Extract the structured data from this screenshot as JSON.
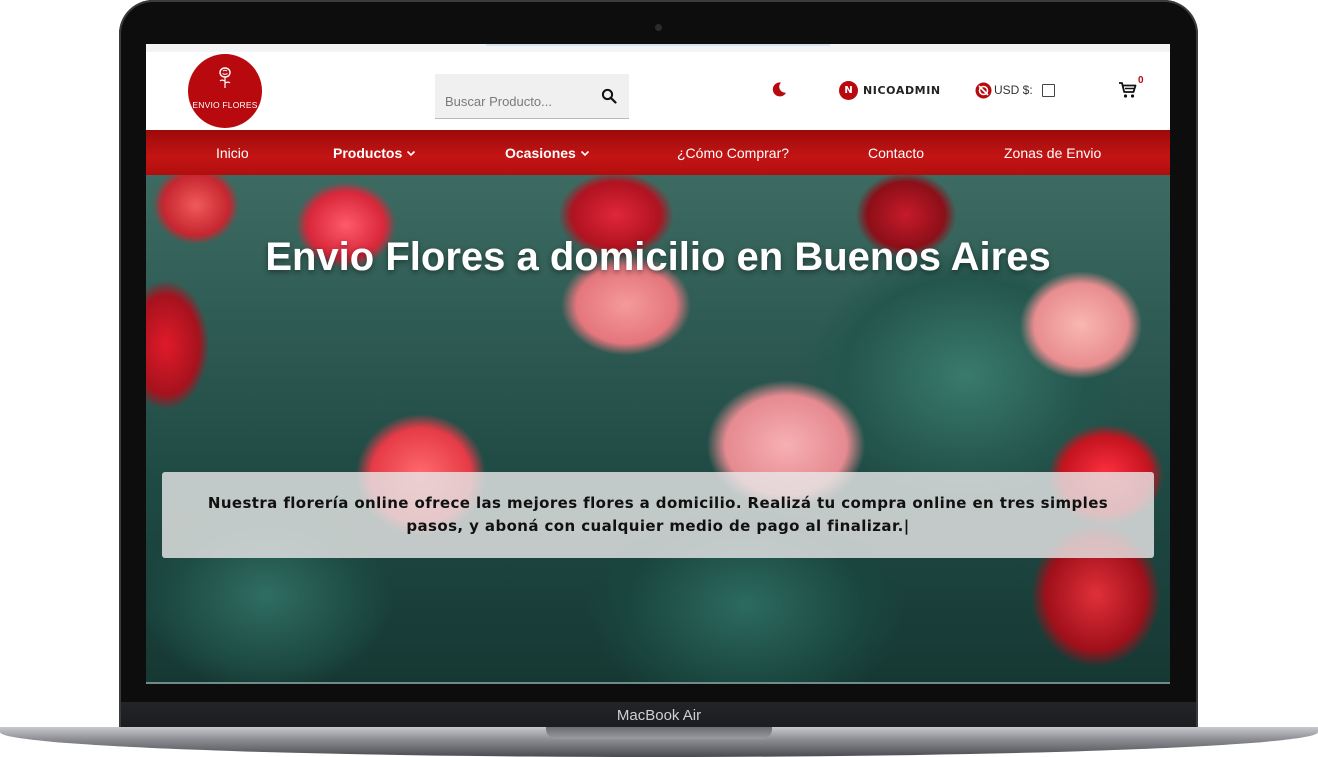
{
  "device": {
    "model_label": "MacBook Air"
  },
  "header": {
    "logo_text": "ENVIO FLORES",
    "search": {
      "placeholder": "Buscar Producto..."
    },
    "user": {
      "initial": "N",
      "name": "NICOADMIN"
    },
    "currency": {
      "label": "USD $:"
    },
    "cart": {
      "count": "0"
    }
  },
  "nav": {
    "items": [
      {
        "label": "Inicio"
      },
      {
        "label": "Productos"
      },
      {
        "label": "Ocasiones"
      },
      {
        "label": "¿Cómo Comprar?"
      },
      {
        "label": "Contacto"
      },
      {
        "label": "Zonas de Envio"
      }
    ]
  },
  "hero": {
    "title": "Envio Flores a domicilio en Buenos Aires",
    "description": "Nuestra florería online ofrece las mejores flores a domicilio. Realizá tu compra online en tres simples pasos, y aboná con cualquier medio de pago al finalizar.|"
  },
  "colors": {
    "brand_red": "#b8090f",
    "nav_red": "#c41414"
  },
  "icons": [
    "rose-logo-icon",
    "search-icon",
    "moon-icon",
    "currency-icon",
    "cart-icon",
    "chevron-down-icon"
  ]
}
